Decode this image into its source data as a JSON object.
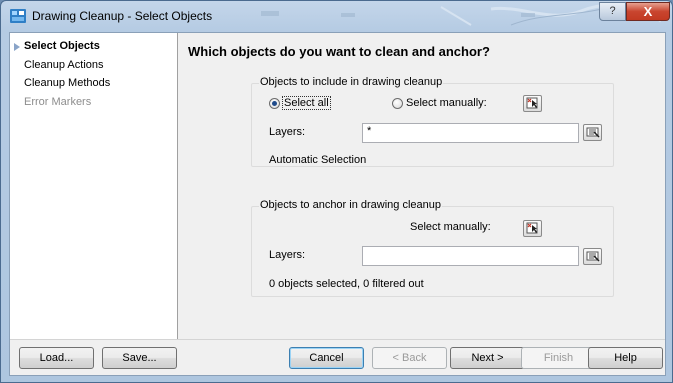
{
  "window": {
    "title": "Drawing Cleanup - Select Objects",
    "help_label": "?",
    "close_label": "X"
  },
  "sidebar": {
    "items": [
      {
        "label": "Select Objects",
        "state": "active"
      },
      {
        "label": "Cleanup Actions",
        "state": "normal"
      },
      {
        "label": "Cleanup Methods",
        "state": "normal"
      },
      {
        "label": "Error Markers",
        "state": "disabled"
      }
    ]
  },
  "main": {
    "heading": "Which objects do you want to clean and anchor?",
    "include_group": {
      "title": "Objects to include in drawing cleanup",
      "select_all_label": "Select all",
      "select_all_checked": true,
      "select_manually_label": "Select manually:",
      "select_manually_checked": false,
      "layers_label": "Layers:",
      "layers_value": "*",
      "status": "Automatic Selection"
    },
    "anchor_group": {
      "title": "Objects to anchor in drawing cleanup",
      "select_manually_label": "Select manually:",
      "layers_label": "Layers:",
      "layers_value": "",
      "status": "0 objects selected, 0 filtered out"
    }
  },
  "footer": {
    "load_label": "Load...",
    "save_label": "Save...",
    "cancel_label": "Cancel",
    "back_label": "< Back",
    "next_label": "Next >",
    "finish_label": "Finish",
    "help_label": "Help"
  },
  "colors": {
    "titlebar": "#b5cbe3",
    "close_button": "#c9452f",
    "dialog_background": "#f0f0f0",
    "sidebar_background": "#ffffff",
    "disabled_text": "#8d8d8d"
  },
  "icons": [
    "app-icon",
    "pick-objects-icon",
    "layer-filter-icon",
    "sidebar-arrow-icon"
  ]
}
